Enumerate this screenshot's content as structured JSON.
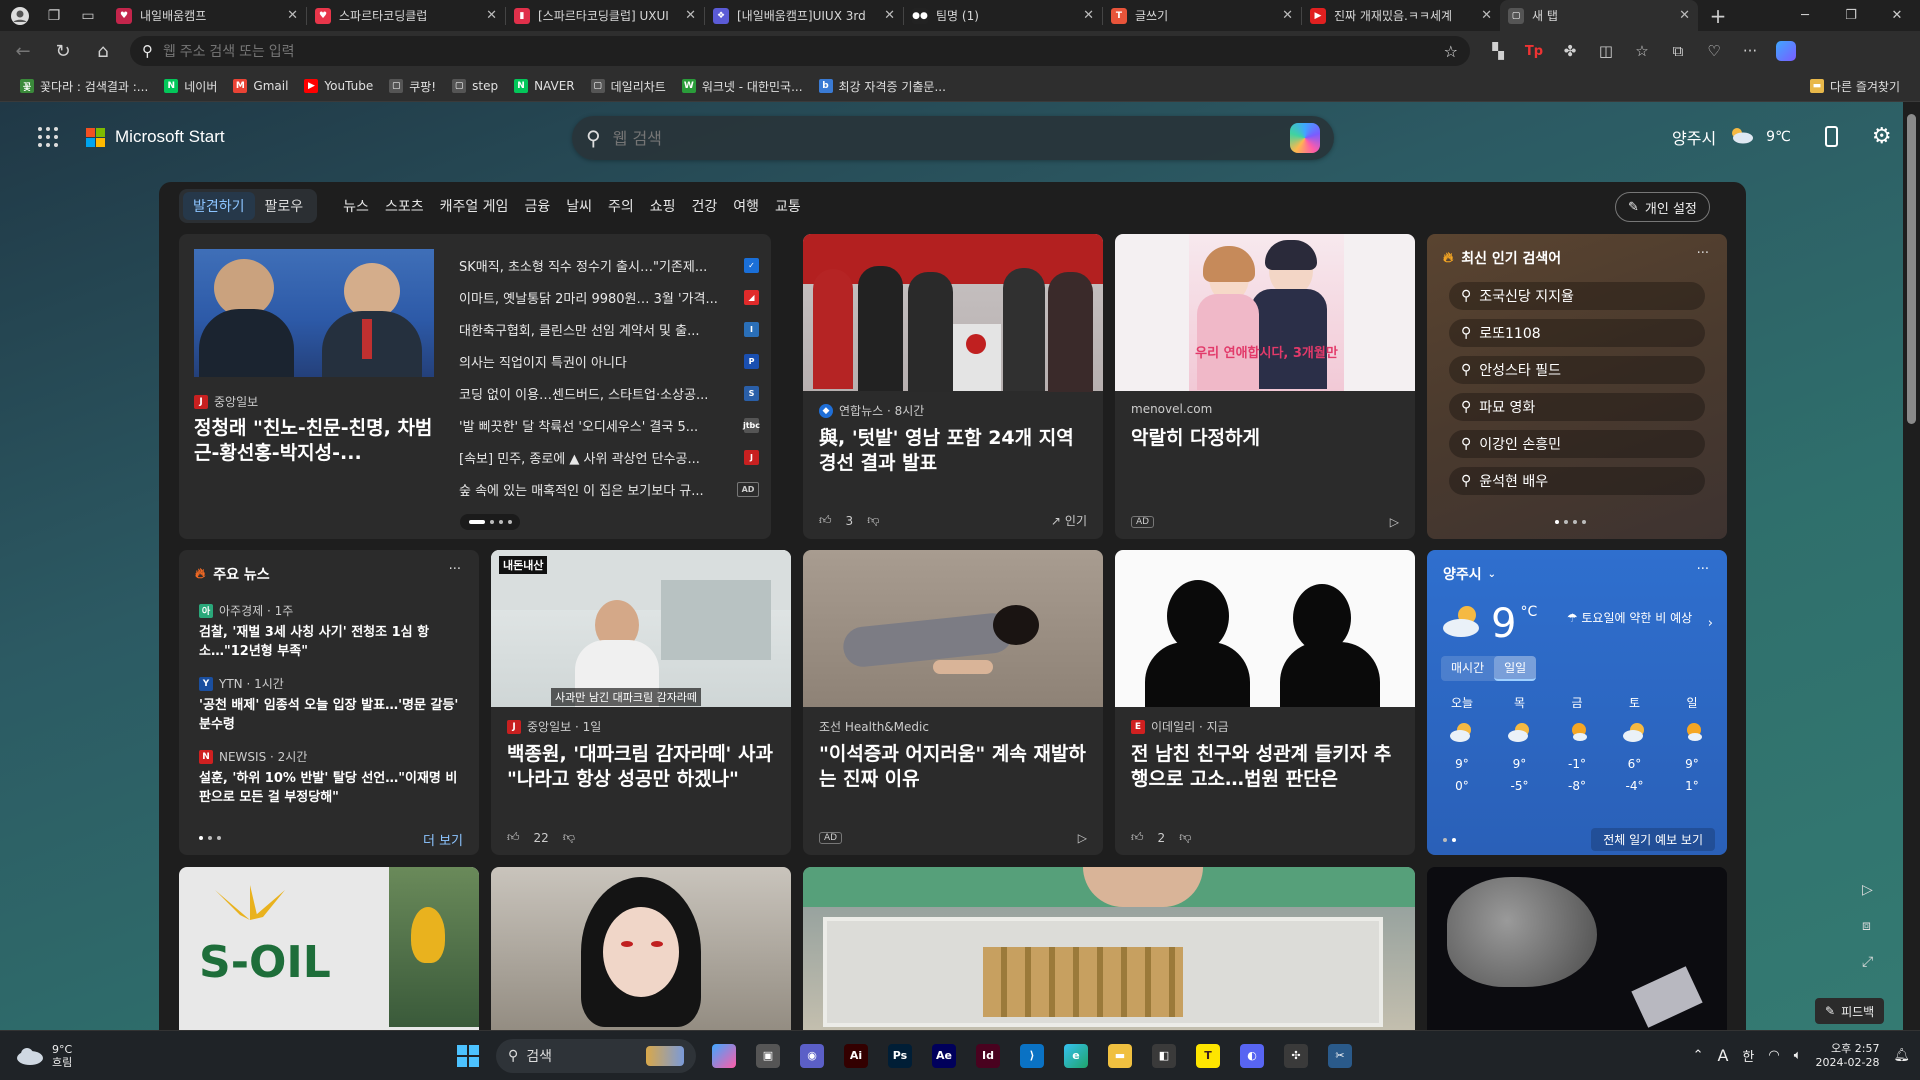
{
  "tabs": [
    {
      "title": "내일배움캠프",
      "color": "#c3254b",
      "glyph": "♥"
    },
    {
      "title": "스파르타코딩클럽",
      "color": "#e8364a",
      "glyph": "♥"
    },
    {
      "title": "[스파르타코딩클럽] UXUI",
      "color": "#e0304a",
      "glyph": "▮"
    },
    {
      "title": "[내일배움캠프]UIUX 3rd",
      "color": "#5b5bd6",
      "glyph": "❖"
    },
    {
      "title": "팀명 (1)",
      "color": "#222",
      "glyph": "●●"
    },
    {
      "title": "글쓰기",
      "color": "#e8543a",
      "glyph": "T"
    },
    {
      "title": "진짜 개재밌음.ㅋㅋ세계",
      "color": "#e02020",
      "glyph": "▶"
    },
    {
      "title": "새 탭",
      "color": "#555",
      "glyph": "▢"
    }
  ],
  "address": {
    "placeholder": "웹 주소 검색 또는 입력"
  },
  "bookmarks": [
    {
      "label": "꽃다라 : 검색결과 :...",
      "color": "#3a8a3a",
      "glyph": "꽃"
    },
    {
      "label": "네이버",
      "color": "#03c75a",
      "glyph": "N"
    },
    {
      "label": "Gmail",
      "color": "#ea4335",
      "glyph": "M"
    },
    {
      "label": "YouTube",
      "color": "#ff0000",
      "glyph": "▶"
    },
    {
      "label": "쿠팡!",
      "color": "#555",
      "glyph": "▢"
    },
    {
      "label": "step",
      "color": "#555",
      "glyph": "▢"
    },
    {
      "label": "NAVER",
      "color": "#03c75a",
      "glyph": "N"
    },
    {
      "label": "데일리차트",
      "color": "#555",
      "glyph": "▢"
    },
    {
      "label": "워크넷 - 대한민국...",
      "color": "#2a9d3a",
      "glyph": "W"
    },
    {
      "label": "최강 자격증 기출문...",
      "color": "#3a7bd5",
      "glyph": "b"
    }
  ],
  "bookmarks_right": "다른 즐겨찾기",
  "brand": "Microsoft Start",
  "search_placeholder": "웹 검색",
  "header_weather": {
    "city": "양주시",
    "temp": "9℃"
  },
  "nav": {
    "discover": "발견하기",
    "follow": "팔로우",
    "items": [
      "뉴스",
      "스포츠",
      "캐주얼 게임",
      "금융",
      "날씨",
      "주의",
      "쇼핑",
      "건강",
      "여행",
      "교통"
    ],
    "personalize": "개인 설정"
  },
  "hero": {
    "source": "중앙일보",
    "title": "정청래 \"친노-친문-친명, 차범근-황선홍-박지성-...",
    "headlines": [
      {
        "text": "SK매직, 초소형 직수 정수기 출시…\"기존제...",
        "color": "#1a6fd8",
        "glyph": "✓"
      },
      {
        "text": "이마트, 옛날통닭 2마리 9980원… 3월 '가격...",
        "color": "#e02a2a",
        "glyph": "◢"
      },
      {
        "text": "대한축구협회, 클린스만 선임 계약서 및 출...",
        "color": "#2a6fb8",
        "glyph": "I"
      },
      {
        "text": "의사는 직업이지 특권이 아니다",
        "color": "#1a4fb0",
        "glyph": "P"
      },
      {
        "text": "코딩 없이 이용…센드버드, 스타트업·소상공...",
        "color": "#2a5fa8",
        "glyph": "S"
      },
      {
        "text": "'발 삐끗한' 달 착륙선 '오디세우스' 결국 5...",
        "color": "#555",
        "glyph": "jtbc"
      },
      {
        "text": "[속보] 민주, 종로에 ▲ 사위 곽상언 단수공...",
        "color": "#c82020",
        "glyph": "J"
      },
      {
        "text": "숲 속에 있는 매혹적인 이 집은 보기보다 규...",
        "color": "#555",
        "glyph": "AD"
      }
    ]
  },
  "card_yonhap": {
    "source": "연합뉴스 · 8시간",
    "title": "與, '텃밭' 영남 포함 24개 지역 경선 결과 발표",
    "likes": "3",
    "trend": "인기"
  },
  "card_novel": {
    "source": "menovel.com",
    "title": "악랄히 다정하게",
    "ad": "AD",
    "cover_text": "우리 연애합시다, 3개월만"
  },
  "trending": {
    "title": "최신 인기 검색어",
    "items": [
      "조국신당 지지율",
      "로또1108",
      "안성스타 필드",
      "파묘 영화",
      "이강인 손흥민",
      "윤석현 배우"
    ]
  },
  "topnews": {
    "title": "주요 뉴스",
    "items": [
      {
        "source": "아주경제 · 1주",
        "title": "검찰, '재벌 3세 사칭 사기' 전청조 1심 항소…\"12년형 부족\"",
        "color": "#2aa87a",
        "glyph": "아"
      },
      {
        "source": "YTN · 1시간",
        "title": "'공천 배제' 임종석 오늘 입장 발표…'명문 갈등' 분수령",
        "color": "#1a4fa0",
        "glyph": "Y"
      },
      {
        "source": "NEWSIS · 2시간",
        "title": "설훈, '하위 10% 반발' 탈당 선언…\"이재명 비판으로 모든 걸 부정당해\"",
        "color": "#d02020",
        "glyph": "N"
      }
    ],
    "more": "더 보기"
  },
  "card_baek": {
    "source": "중앙일보 · 1일",
    "title": "백종원, '대파크림 감자라떼' 사과 \"나라고 항상 성공만 하겠나\"",
    "likes": "22",
    "video_caption": "사과만 남긴 대파크림 감자라떼",
    "video_tag": "내돈내산"
  },
  "card_health": {
    "source": "조선 Health&Medic",
    "title": "\"이석증과 어지러움\" 계속 재발하는 진짜 이유",
    "ad": "AD"
  },
  "card_edaily": {
    "source": "이데일리 · 지금",
    "title": "전 남친 친구와 성관계 들키자 추행으로 고소…법원 판단은",
    "likes": "2"
  },
  "weather": {
    "city": "양주시",
    "temp": "9",
    "unit": "°C",
    "note": "토요일에 약한 비 예상",
    "tab_hourly": "매시간",
    "tab_daily": "일일",
    "days": [
      {
        "d": "오늘",
        "hi": "9°",
        "lo": "0°"
      },
      {
        "d": "목",
        "hi": "9°",
        "lo": "-5°"
      },
      {
        "d": "금",
        "hi": "-1°",
        "lo": "-8°"
      },
      {
        "d": "토",
        "hi": "6°",
        "lo": "-4°"
      },
      {
        "d": "일",
        "hi": "9°",
        "lo": "1°"
      }
    ],
    "full": "전체 일기 예보 보기"
  },
  "bottom_cards": [
    "S-OIL"
  ],
  "feedback": "피드백",
  "taskbar": {
    "weather_temp": "9°C",
    "weather_desc": "흐림",
    "search": "검색",
    "ime_a": "A",
    "ime_han": "한",
    "time": "오후 2:57",
    "date": "2024-02-28"
  },
  "colors": {
    "accent": "#8cc4ff",
    "weather_card": "#2a66c7",
    "trending_card": "#4a3a2a"
  }
}
